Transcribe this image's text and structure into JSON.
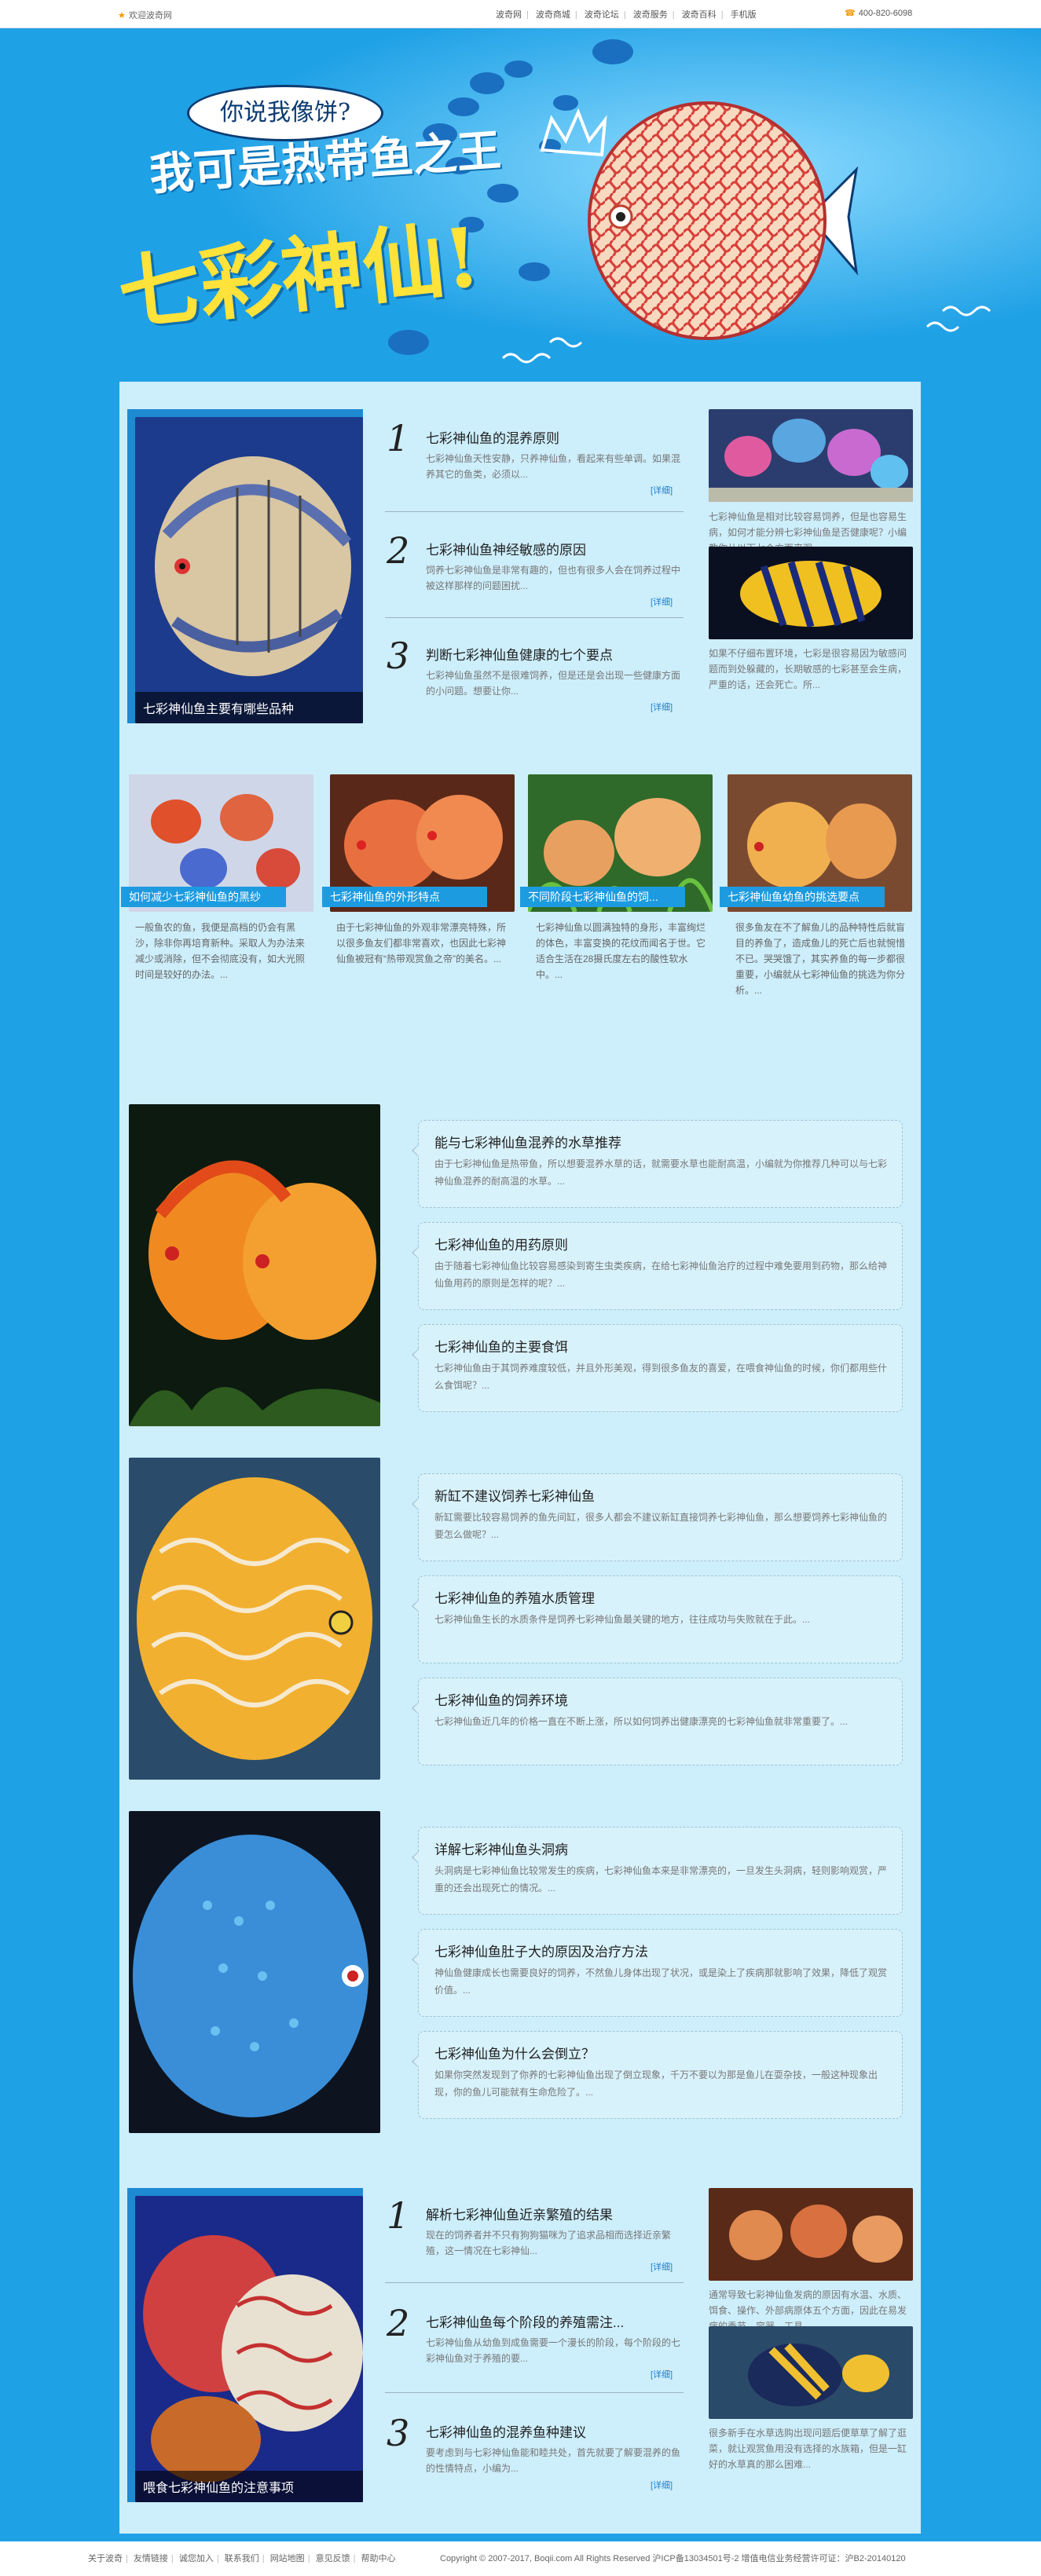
{
  "topbar": {
    "welcome": "欢迎波奇网",
    "nav": [
      "波奇网",
      "波奇商城",
      "波奇论坛",
      "波奇服务",
      "波奇百科",
      "手机版"
    ],
    "phone": "400-820-6098"
  },
  "banner": {
    "bubble": "你说我像饼?",
    "slogan_line1": "我可是热带鱼之王",
    "slogan_line2": "七彩神仙!"
  },
  "section1": {
    "lead_caption": "七彩神仙鱼主要有哪些品种",
    "items": [
      {
        "num": "1",
        "title": "七彩神仙鱼的混养原则",
        "desc": "七彩神仙鱼天性安静，只养神仙鱼，看起来有些单调。如果混养其它的鱼类，必须以...",
        "more": "[详细]"
      },
      {
        "num": "2",
        "title": "七彩神仙鱼神经敏感的原因",
        "desc": "饲养七彩神仙鱼是非常有趣的，但也有很多人会在饲养过程中被这样那样的问题困扰...",
        "more": "[详细]"
      },
      {
        "num": "3",
        "title": "判断七彩神仙鱼健康的七个要点",
        "desc": "七彩神仙鱼虽然不是很难饲养，但是还是会出现一些健康方面的小问题。想要让你...",
        "more": "[详细]"
      }
    ],
    "side": [
      {
        "caption": "七彩神仙鱼是相对比较容易饲养，但是也容易生病，如何才能分辨七彩神仙鱼是否健康呢？小编教你从以下七个方面来观..."
      },
      {
        "caption": "如果不仔细布置环境，七彩是很容易因为敏感问题而到处躲藏的，长期敏感的七彩甚至会生病，严重的话，还会死亡。所..."
      }
    ]
  },
  "section2": {
    "items": [
      {
        "title": "如何减少七彩神仙鱼的黑纱",
        "desc": "一般鱼农的鱼，我便是高档的仍会有黑沙，除非你再培育新种。采取人为办法来减少或消除，但不会彻底没有，如大光照时间是较好的办法。..."
      },
      {
        "title": "七彩神仙鱼的外形特点",
        "desc": "由于七彩神仙鱼的外观非常漂亮特殊，所以很多鱼友们都非常喜欢，也因此七彩神仙鱼被冠有“热带观赏鱼之帝”的美名。..."
      },
      {
        "title": "不同阶段七彩神仙鱼的饲...",
        "desc": "七彩神仙鱼以圆满独特的身形，丰富绚烂的体色，丰富变换的花纹而闻名于世。它适合生活在28摄氏度左右的酸性软水中。..."
      },
      {
        "title": "七彩神仙鱼幼鱼的挑选要点",
        "desc": "很多鱼友在不了解鱼儿的品种特性后就盲目的养鱼了，造成鱼儿的死亡后也就惋惜不已。哭哭饿了，其实养鱼的每一步都很重要，小编就从七彩神仙鱼的挑选为你分析。..."
      }
    ]
  },
  "section3": [
    {
      "title": "能与七彩神仙鱼混养的水草推荐",
      "desc": "由于七彩神仙鱼是热带鱼，所以想要混养水草的话，就需要水草也能耐高温，小编就为你推荐几种可以与七彩神仙鱼混养的耐高温的水草。..."
    },
    {
      "title": "七彩神仙鱼的用药原则",
      "desc": "由于随着七彩神仙鱼比较容易感染到寄生虫类疾病，在给七彩神仙鱼治疗的过程中难免要用到药物，那么给神仙鱼用药的原则是怎样的呢？..."
    },
    {
      "title": "七彩神仙鱼的主要食饵",
      "desc": "七彩神仙鱼由于其饲养难度较低，并且外形美观，得到很多鱼友的喜爱，在喂食神仙鱼的时候，你们都用些什么食饵呢？..."
    }
  ],
  "section4": [
    {
      "title": "新缸不建议饲养七彩神仙鱼",
      "desc": "新缸需要比较容易饲养的鱼先间缸，很多人都会不建议新缸直接饲养七彩神仙鱼，那么想要饲养七彩神仙鱼的要怎么做呢？..."
    },
    {
      "title": "七彩神仙鱼的养殖水质管理",
      "desc": "七彩神仙鱼生长的水质条件是饲养七彩神仙鱼最关键的地方，往往成功与失败就在于此。..."
    },
    {
      "title": "七彩神仙鱼的饲养环境",
      "desc": "七彩神仙鱼近几年的价格一直在不断上涨，所以如何饲养出健康漂亮的七彩神仙鱼就非常重要了。..."
    }
  ],
  "section5": [
    {
      "title": "详解七彩神仙鱼头洞病",
      "desc": "头洞病是七彩神仙鱼比较常发生的疾病，七彩神仙鱼本来是非常漂亮的，一旦发生头洞病，轻则影响观赏，严重的还会出现死亡的情况。..."
    },
    {
      "title": "七彩神仙鱼肚子大的原因及治疗方法",
      "desc": "神仙鱼健康成长也需要良好的饲养，不然鱼儿身体出现了状况，或是染上了疾病那就影响了效果，降低了观赏价值。..."
    },
    {
      "title": "七彩神仙鱼为什么会倒立？",
      "desc": "如果你突然发现到了你养的七彩神仙鱼出现了倒立现象，千万不要以为那是鱼儿在耍杂技，一般这种现象出现，你的鱼儿可能就有生命危险了。..."
    }
  ],
  "section6": {
    "lead_caption": "喂食七彩神仙鱼的注意事项",
    "items": [
      {
        "num": "1",
        "title": "解析七彩神仙鱼近亲繁殖的结果",
        "desc": "现在的饲养者并不只有狗狗猫咪为了追求品相而选择近亲繁殖，这一情况在七彩神仙...",
        "more": "[详细]"
      },
      {
        "num": "2",
        "title": "七彩神仙鱼每个阶段的养殖需注...",
        "desc": "七彩神仙鱼从幼鱼到成鱼需要一个漫长的阶段，每个阶段的七彩神仙鱼对于养殖的要...",
        "more": "[详细]"
      },
      {
        "num": "3",
        "title": "七彩神仙鱼的混养鱼种建议",
        "desc": "要考虑到与七彩神仙鱼能和睦共处，首先就要了解要混养的鱼的性情特点，小编为...",
        "more": "[详细]"
      }
    ],
    "side": [
      {
        "caption": "通常导致七彩神仙鱼发病的原因有水温、水质、饵食、操作、外部病原体五个方面，因此在易发病的季节，容器、工具..."
      },
      {
        "caption": "很多新手在水草选购出现问题后便草草了解了逛菜，就让观赏鱼用没有选择的水族箱，但是一缸好的水草真的那么困难..."
      }
    ]
  },
  "footer": {
    "links": [
      "关于波奇",
      "友情链接",
      "诚您加入",
      "联系我们",
      "网站地图",
      "意见反馈",
      "帮助中心"
    ],
    "copyright": "Copyright © 2007-2017, Boqii.com All Rights Reserved  沪ICP备13034501号-2  增值电信业务经营许可证：沪B2-20140120"
  },
  "colors": {
    "bg_blue": "#1fa1e6",
    "panel": "#cdeefb",
    "accent": "#1d9be0",
    "title_yellow": "#ffe23a"
  }
}
